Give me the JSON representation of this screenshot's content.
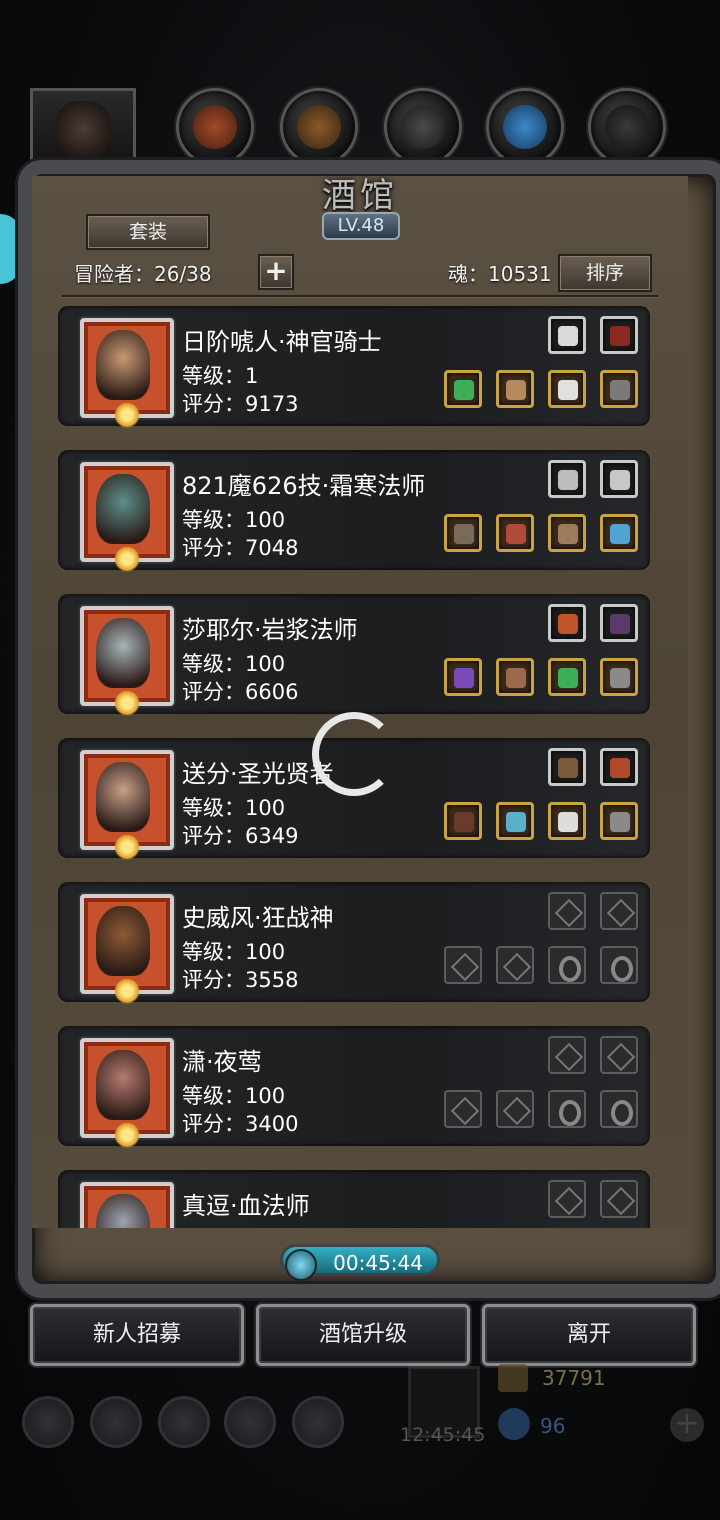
{
  "header": {
    "title": "酒馆",
    "level_badge": "LV.48",
    "set_button": "套装",
    "adventurers_label": "冒险者：26/38",
    "add_button": "+",
    "soul_label": "魂：10531",
    "sort_button": "排序"
  },
  "heroes": [
    {
      "name": "日阶唬人·神官骑士",
      "level": "等级：1",
      "score": "评分：9173",
      "face": "#c89a72",
      "equip_filled": true
    },
    {
      "name": "821魔626技·霜寒法师",
      "level": "等级：100",
      "score": "评分：7048",
      "face": "#5d8f8a",
      "equip_filled": true
    },
    {
      "name": "莎耶尔·岩浆法师",
      "level": "等级：100",
      "score": "评分：6606",
      "face": "#a8b4b8",
      "equip_filled": true
    },
    {
      "name": "送分·圣光贤者",
      "level": "等级：100",
      "score": "评分：6349",
      "face": "#c7a08a",
      "equip_filled": true
    },
    {
      "name": "史威风·狂战神",
      "level": "等级：100",
      "score": "评分：3558",
      "face": "#8d5a35",
      "equip_filled": false
    },
    {
      "name": "潇·夜莺",
      "level": "等级：100",
      "score": "评分：3400",
      "face": "#b67a70",
      "equip_filled": false
    },
    {
      "name": "真逗·血法师",
      "level": "",
      "score": "",
      "face": "#9ea4b0",
      "equip_filled": false
    }
  ],
  "timer": "00:45:44",
  "buttons": {
    "recruit": "新人招募",
    "upgrade": "酒馆升级",
    "leave": "离开"
  },
  "background_hud": {
    "gold": "37791",
    "gems": "96",
    "clock": "12:45:45"
  },
  "colors": {
    "panel": "#5b5142",
    "card": "#1f2123",
    "gold_border": "#c9a442",
    "timer": "#34b1c4"
  }
}
